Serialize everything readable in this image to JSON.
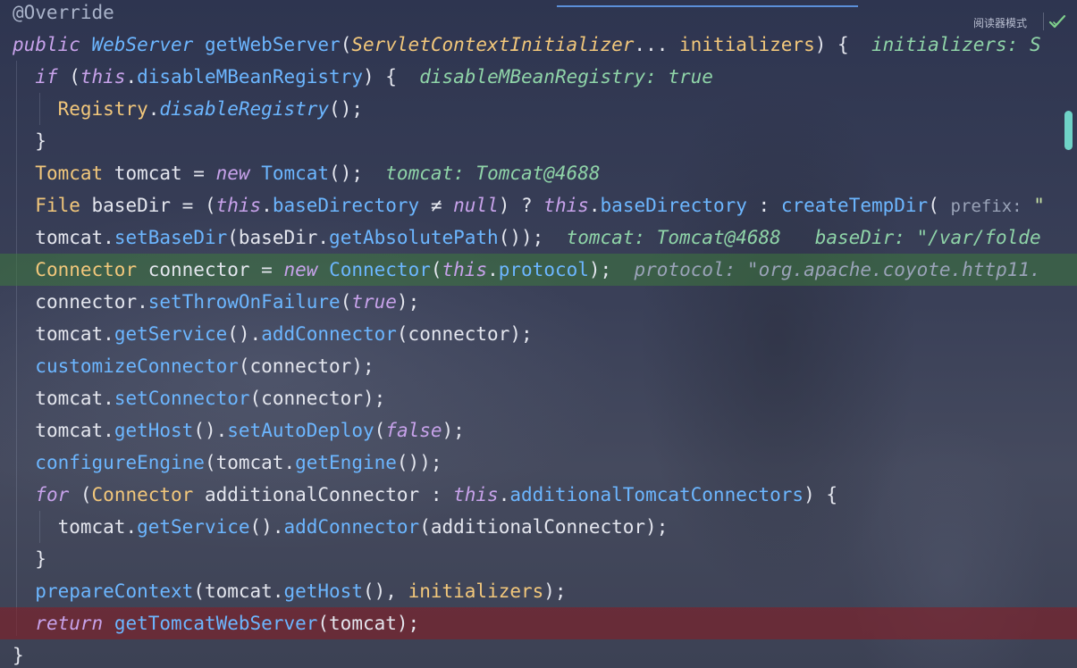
{
  "toolbar": {
    "reader_mode_label": "阅读器模式",
    "check_icon": "check-icon"
  },
  "code": {
    "l0_annotation": "@Override",
    "l1_public": "public",
    "l1_type": "WebServer",
    "l1_method": "getWebServer",
    "l1_open": "(",
    "l1_param_type": "ServletContextInitializer",
    "l1_varargs": "... ",
    "l1_param": "initializers",
    "l1_close": ") {",
    "l1_inlay": "initializers: S",
    "l2_if": "if",
    "l2_open": " (",
    "l2_this": "this",
    "l2_dot": ".",
    "l2_field": "disableMBeanRegistry",
    "l2_close": ") {",
    "l2_inlay": "disableMBeanRegistry: true",
    "l3_type": "Registry",
    "l3_dot": ".",
    "l3_method": "disableRegistry",
    "l3_end": "();",
    "l4_brace": "}",
    "l5_type": "Tomcat",
    "l5_var": " tomcat = ",
    "l5_new": "new",
    "l5_sp": " ",
    "l5_ctor": "Tomcat",
    "l5_end": "();",
    "l5_inlay": "tomcat: Tomcat@4688",
    "l6_type": "File",
    "l6_var": " baseDir = (",
    "l6_this": "this",
    "l6_dot": ".",
    "l6_field": "baseDirectory",
    "l6_neq": " ≠ ",
    "l6_null": "null",
    "l6_q": ") ? ",
    "l6_this2": "this",
    "l6_dot2": ".",
    "l6_field2": "baseDirectory",
    "l6_colon": " : ",
    "l6_method": "createTempDir",
    "l6_paren": "( ",
    "l6_hint": "prefix:",
    "l6_str": " \"",
    "l7_var": "tomcat",
    "l7_dot": ".",
    "l7_method": "setBaseDir",
    "l7_open": "(baseDir.",
    "l7_method2": "getAbsolutePath",
    "l7_end": "());",
    "l7_inlay1": "tomcat: Tomcat@4688",
    "l7_inlay2": "baseDir: \"/var/folde",
    "l8_type": "Connector",
    "l8_var": " connector = ",
    "l8_new": "new",
    "l8_sp": " ",
    "l8_ctor": "Connector",
    "l8_open": "(",
    "l8_this": "this",
    "l8_dot": ".",
    "l8_field": "protocol",
    "l8_end": ");",
    "l8_inlay": "protocol: \"org.apache.coyote.http11.",
    "l9_var": "connector",
    "l9_dot": ".",
    "l9_method": "setThrowOnFailure",
    "l9_open": "(",
    "l9_true": "true",
    "l9_end": ");",
    "l10_var": "tomcat",
    "l10_dot": ".",
    "l10_method": "getService",
    "l10_mid": "().",
    "l10_method2": "addConnector",
    "l10_end": "(connector);",
    "l11_method": "customizeConnector",
    "l11_end": "(connector);",
    "l12_var": "tomcat",
    "l12_dot": ".",
    "l12_method": "setConnector",
    "l12_end": "(connector);",
    "l13_var": "tomcat",
    "l13_dot": ".",
    "l13_method": "getHost",
    "l13_mid": "().",
    "l13_method2": "setAutoDeploy",
    "l13_open": "(",
    "l13_false": "false",
    "l13_end": ");",
    "l14_method": "configureEngine",
    "l14_open": "(tomcat.",
    "l14_method2": "getEngine",
    "l14_end": "());",
    "l15_for": "for",
    "l15_open": " (",
    "l15_type": "Connector",
    "l15_var": " additionalConnector : ",
    "l15_this": "this",
    "l15_dot": ".",
    "l15_field": "additionalTomcatConnectors",
    "l15_close": ") {",
    "l16_var": "tomcat",
    "l16_dot": ".",
    "l16_method": "getService",
    "l16_mid": "().",
    "l16_method2": "addConnector",
    "l16_end": "(additionalConnector);",
    "l17_brace": "}",
    "l18_method": "prepareContext",
    "l18_open": "(tomcat.",
    "l18_method2": "getHost",
    "l18_mid": "(), ",
    "l18_param": "initializers",
    "l18_end": ");",
    "l19_return": "return",
    "l19_sp": " ",
    "l19_method": "getTomcatWebServer",
    "l19_end": "(tomcat);",
    "l20_brace": "}"
  }
}
